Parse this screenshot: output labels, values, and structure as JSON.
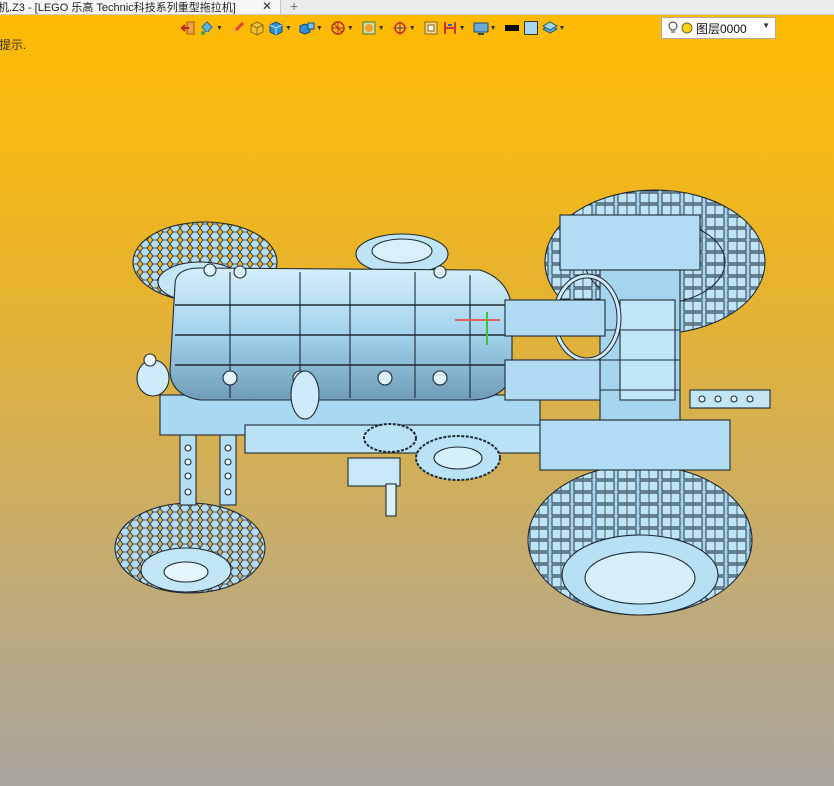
{
  "window": {
    "tab_title": "机.Z3 - [LEGO 乐高 Technic科技系列重型拖拉机]",
    "close_glyph": "✕",
    "add_glyph": "+"
  },
  "toolbar": {
    "icons": [
      "exit-icon",
      "paint-bucket-icon",
      "brush-icon",
      "box-solid-icon",
      "cube-icon",
      "cube-multi-icon",
      "wheel-view-icon",
      "render-icon",
      "axis-icon",
      "frame-icon",
      "bracket-icon",
      "display-icon",
      "line-color-icon",
      "fill-color-icon",
      "layer-stack-icon"
    ],
    "line_color": "#000000",
    "fill_color": "#a9d8f2"
  },
  "layer": {
    "current": "图层0000",
    "bulb_color": "#f2d21a"
  },
  "status": {
    "hint": "提示."
  },
  "model": {
    "name": "tractor-3d-model",
    "body_color": "#a9d8f2",
    "edge_color": "#1e2a33"
  }
}
